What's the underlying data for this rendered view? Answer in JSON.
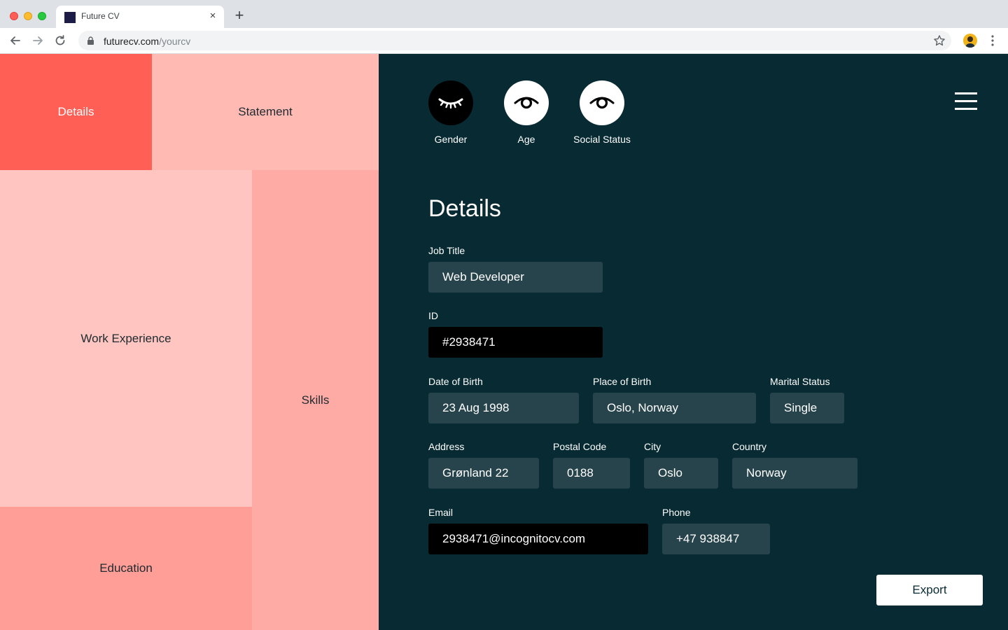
{
  "browser": {
    "tab_title": "Future CV",
    "tab_close": "×",
    "new_tab": "+",
    "url_domain": "futurecv.com",
    "url_path": "/yourcv"
  },
  "sections": {
    "details": "Details",
    "statement": "Statement",
    "work_experience": "Work Experience",
    "skills": "Skills",
    "education": "Education"
  },
  "toggles": {
    "gender": {
      "label": "Gender",
      "state": "hidden",
      "icon": "eye-closed-icon"
    },
    "age": {
      "label": "Age",
      "state": "visible",
      "icon": "eye-open-icon"
    },
    "social_status": {
      "label": "Social Status",
      "state": "visible",
      "icon": "eye-open-icon"
    }
  },
  "form": {
    "title": "Details",
    "job_title": {
      "label": "Job Title",
      "value": "Web Developer"
    },
    "id": {
      "label": "ID",
      "value": "#2938471"
    },
    "date_of_birth": {
      "label": "Date of Birth",
      "value": "23 Aug 1998"
    },
    "place_of_birth": {
      "label": "Place of Birth",
      "value": "Oslo, Norway"
    },
    "marital_status": {
      "label": "Marital Status",
      "value": "Single"
    },
    "address": {
      "label": "Address",
      "value": "Grønland 22"
    },
    "postal_code": {
      "label": "Postal Code",
      "value": "0188"
    },
    "city": {
      "label": "City",
      "value": "Oslo"
    },
    "country": {
      "label": "Country",
      "value": "Norway"
    },
    "email": {
      "label": "Email",
      "value": "2938471@incognitocv.com"
    },
    "phone": {
      "label": "Phone",
      "value": "+47 938847"
    }
  },
  "actions": {
    "export": "Export"
  },
  "colors": {
    "panel_bg": "#072a33",
    "field_bg": "#27444c",
    "details_block": "#ff5f55",
    "statement_block": "#ffbab4",
    "work_block": "#ffc6c1",
    "skills_block": "#ffaba5",
    "education_block": "#ff9e97"
  }
}
